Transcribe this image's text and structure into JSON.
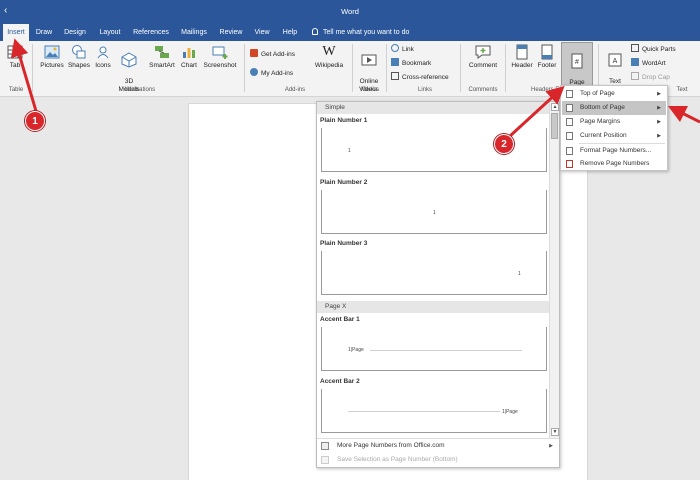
{
  "window": {
    "title": "Word",
    "back_glyph": "‹"
  },
  "tabs": [
    "Insert",
    "Draw",
    "Design",
    "Layout",
    "References",
    "Mailings",
    "Review",
    "View",
    "Help"
  ],
  "tell_me": "Tell me what you want to do",
  "ribbon": {
    "tables_label": "Tab",
    "pictures": "Pictures",
    "shapes": "Shapes",
    "icons": "Icons",
    "models_3d": "3D\nModels",
    "smartart": "SmartArt",
    "chart": "Chart",
    "screenshot": "Screenshot",
    "get_addins": "Get Add-ins",
    "my_addins": "My Add-ins",
    "wikipedia": "Wikipedia",
    "online_videos": "Online\nVideos",
    "link": "Link",
    "bookmark": "Bookmark",
    "cross_reference": "Cross-reference",
    "comment": "Comment",
    "header": "Header",
    "footer": "Footer",
    "page_number": "Page\nNumber",
    "text_box": "Text\nBox",
    "quick_parts": "Quick Parts",
    "wordart": "WordArt",
    "drop_cap": "Drop Cap",
    "groups": {
      "tables": "Table",
      "illustrations": "Illustrations",
      "addins": "Add-ins",
      "media": "Media",
      "links": "Links",
      "comments": "Comments",
      "header_footer": "Headers F",
      "text": "Text"
    }
  },
  "gallery": {
    "section_simple": "Simple",
    "section_pagex": "Page X",
    "items": [
      "Plain Number 1",
      "Plain Number 2",
      "Plain Number 3",
      "Accent Bar 1",
      "Accent Bar 2"
    ],
    "thumb_number": "1",
    "accent_text": "1|Page",
    "more": "More Page Numbers from Office.com",
    "save_selection": "Save Selection as Page Number (Bottom)",
    "scroll_up": "▲",
    "scroll_down": "▼",
    "submenu_arrow": "▶"
  },
  "submenu": {
    "items": [
      "Top of Page",
      "Bottom of Page",
      "Page Margins",
      "Current Position",
      "Format Page Numbers...",
      "Remove Page Numbers"
    ],
    "highlighted": "Bottom of Page",
    "arrow": "▶"
  },
  "annotations": [
    "1",
    "2"
  ],
  "colors": {
    "accent": "#2b579a",
    "annotation": "#d9262b"
  }
}
